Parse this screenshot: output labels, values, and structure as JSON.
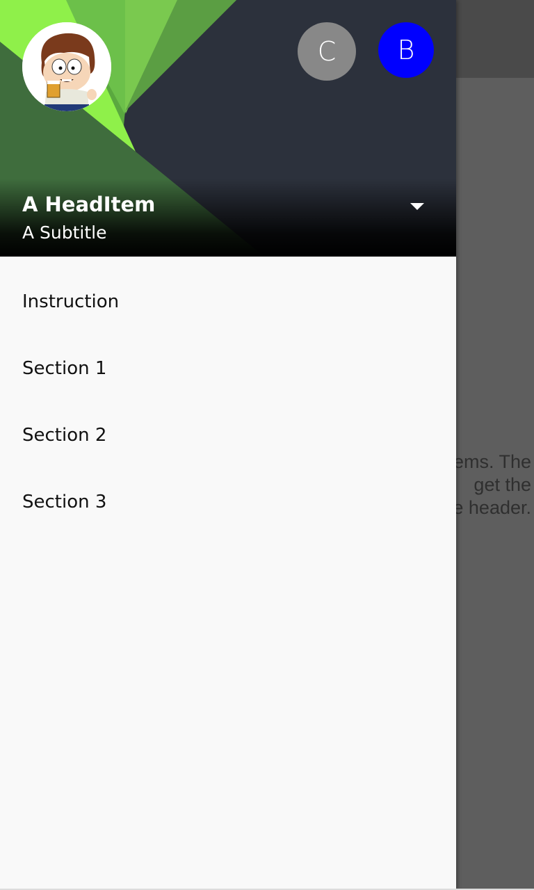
{
  "background_app": {
    "text_lines": [
      "ems. The",
      "get the",
      "e header."
    ]
  },
  "drawer": {
    "header": {
      "title": "A HeadItem",
      "subtitle": "A Subtitle",
      "profiles": [
        {
          "letter": "C",
          "color": "#888888"
        },
        {
          "letter": "B",
          "color": "#0000ff"
        }
      ],
      "avatar_icon": "cartoon-avatar-icon",
      "dropdown_icon": "caret-down-icon"
    },
    "items": [
      {
        "label": "Instruction"
      },
      {
        "label": "Section 1"
      },
      {
        "label": "Section 2"
      },
      {
        "label": "Section 3"
      }
    ]
  },
  "colors": {
    "header_dark": "#2c313c",
    "header_green_light": "#8ff04a",
    "header_green_mid": "#5fae43",
    "header_green_dark": "#3e7a3a",
    "drawer_bg": "#f9f9f9",
    "scrim": "#5e5e5e"
  }
}
